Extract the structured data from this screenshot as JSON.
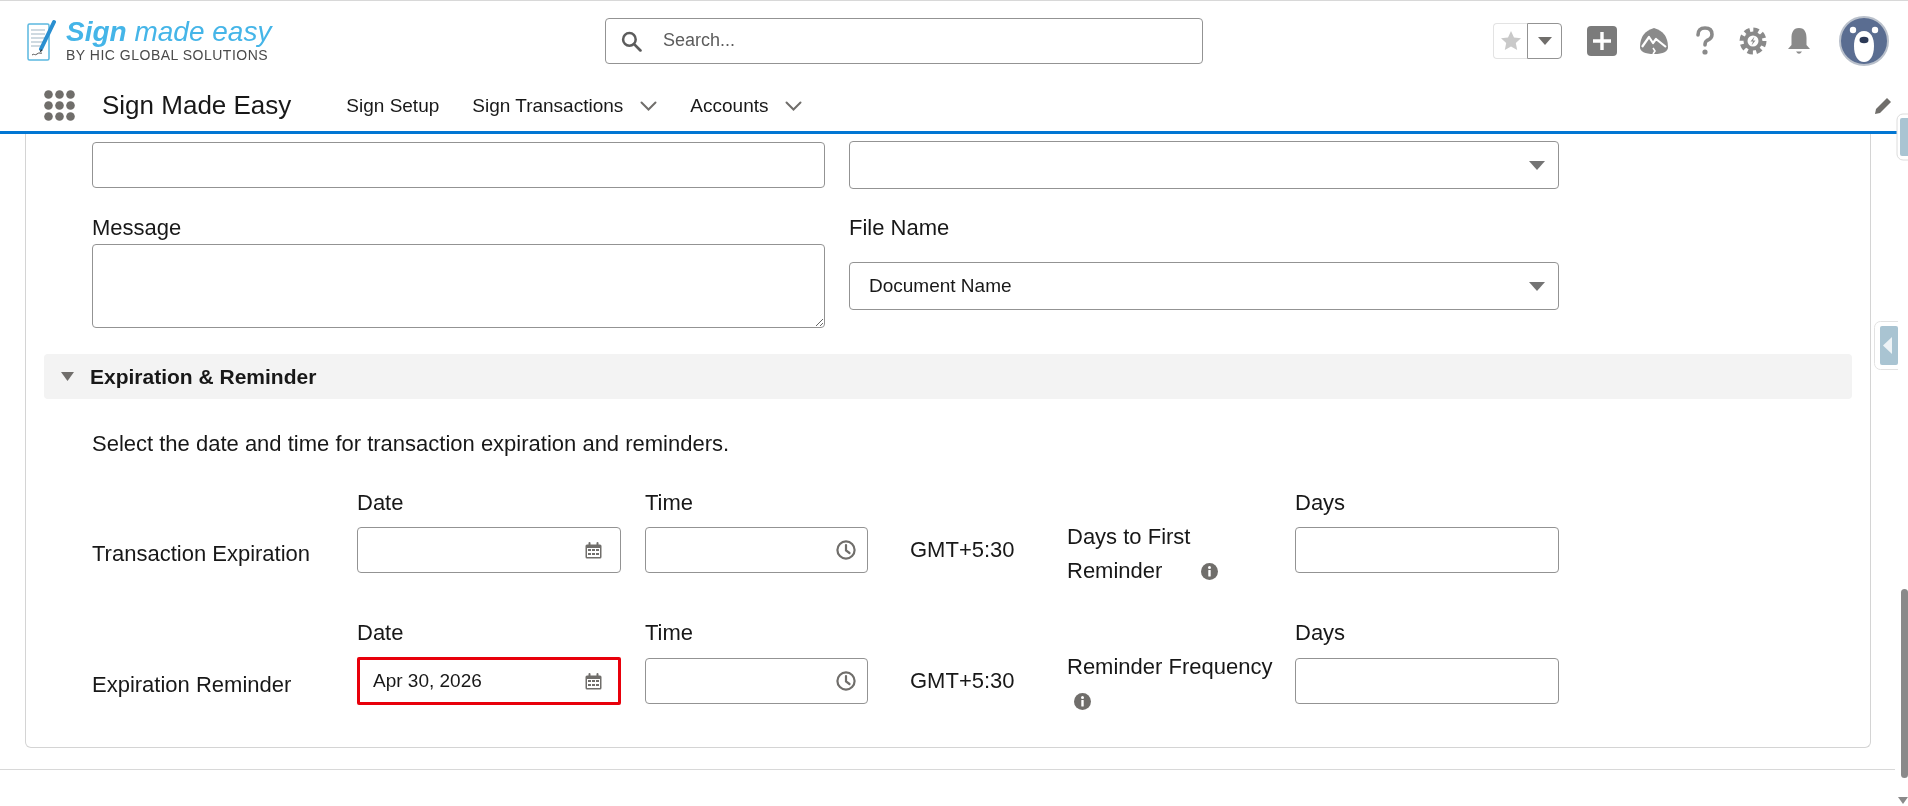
{
  "header": {
    "logo": {
      "title": "**Sign** made easy",
      "subtitle": "BY HIC GLOBAL SOLUTIONS"
    },
    "search": {
      "placeholder": "Search..."
    }
  },
  "nav": {
    "app_name": "Sign Made Easy",
    "items": [
      {
        "label": "Sign Setup",
        "has_menu": false,
        "selected": false
      },
      {
        "label": "Sign Transactions",
        "has_menu": true,
        "selected": false
      },
      {
        "label": "Accounts",
        "has_menu": true,
        "selected": false
      }
    ]
  },
  "form": {
    "fields": [
      {
        "kind": "text"
      },
      {
        "kind": "select"
      },
      {
        "kind": "textarea",
        "label": "Message"
      },
      {
        "kind": "select",
        "label": "File Name",
        "value": "Document Name"
      }
    ]
  },
  "section": {
    "title": "Expiration & Reminder",
    "expanded": true,
    "description": "Select the date and time for transaction expiration and reminders.",
    "rows": [
      {
        "label": "Transaction Expiration",
        "date": {
          "label": "Date",
          "highlighted": false
        },
        "time": {
          "label": "Time"
        },
        "timezone": "GMT+5:30",
        "days": {
          "label": "Days",
          "caption": "Days to First Reminder"
        }
      },
      {
        "label": "Expiration Reminder",
        "date": {
          "label": "Date",
          "value": "Apr 30, 2026",
          "highlighted": true
        },
        "time": {
          "label": "Time"
        },
        "timezone": "GMT+5:30",
        "days": {
          "label": "Days",
          "caption": "Reminder Frequency"
        }
      }
    ]
  }
}
